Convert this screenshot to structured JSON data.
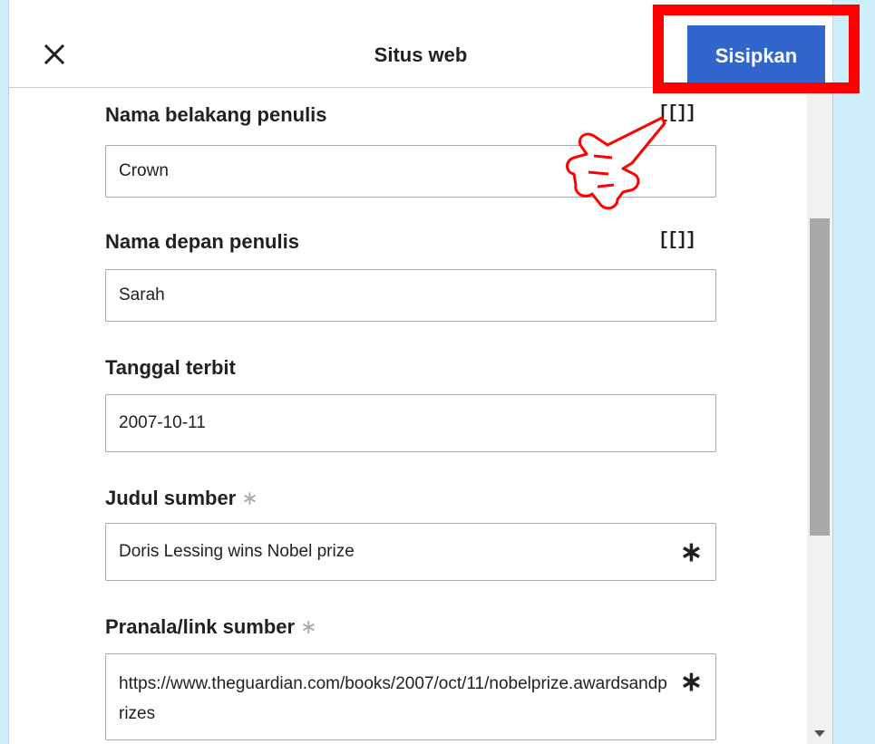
{
  "dialog": {
    "title": "Situs web",
    "insert_label": "Sisipkan"
  },
  "fields": [
    {
      "label": "Nama belakang penulis",
      "value": "Crown",
      "wikilink": "[[]]"
    },
    {
      "label": "Nama depan penulis",
      "value": "Sarah",
      "wikilink": "[[]]"
    },
    {
      "label": "Tanggal terbit",
      "value": "2007-10-11"
    },
    {
      "label": "Judul sumber",
      "required_mark": "∗",
      "value": "Doris Lessing wins Nobel prize",
      "value_mark": "∗"
    },
    {
      "label": "Pranala/link sumber",
      "required_mark": "∗",
      "value": "https://www.theguardian.com/books/2007/oct/11/nobelprize.awardsandprizes",
      "value_mark": "∗"
    }
  ],
  "colors": {
    "accent": "#3366cc",
    "highlight": "#ff0000",
    "page_background": "#cfeefc"
  },
  "icons": [
    "close-icon",
    "pointing-hand-icon",
    "chevron-down-icon"
  ]
}
